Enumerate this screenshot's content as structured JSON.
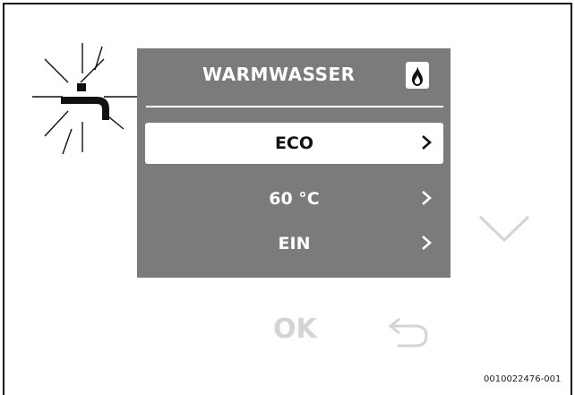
{
  "screen": {
    "title": "WARMWASSER",
    "title_icon": "flame-icon",
    "menu_items": [
      {
        "label": "ECO",
        "selected": true
      },
      {
        "label": "60 °C",
        "selected": false
      },
      {
        "label": "EIN",
        "selected": false
      }
    ]
  },
  "controls": {
    "ok_label": "OK",
    "down_icon": "chevron-down-icon",
    "back_icon": "back-arrow-icon",
    "tap_icon": "hot-water-tap-icon"
  },
  "figure_ref": "0010022476-001",
  "colors": {
    "screen_bg": "#7b7b7b",
    "text_on_screen": "#ffffff",
    "selected_bg": "#ffffff",
    "inactive_control": "#d4d4d4"
  }
}
